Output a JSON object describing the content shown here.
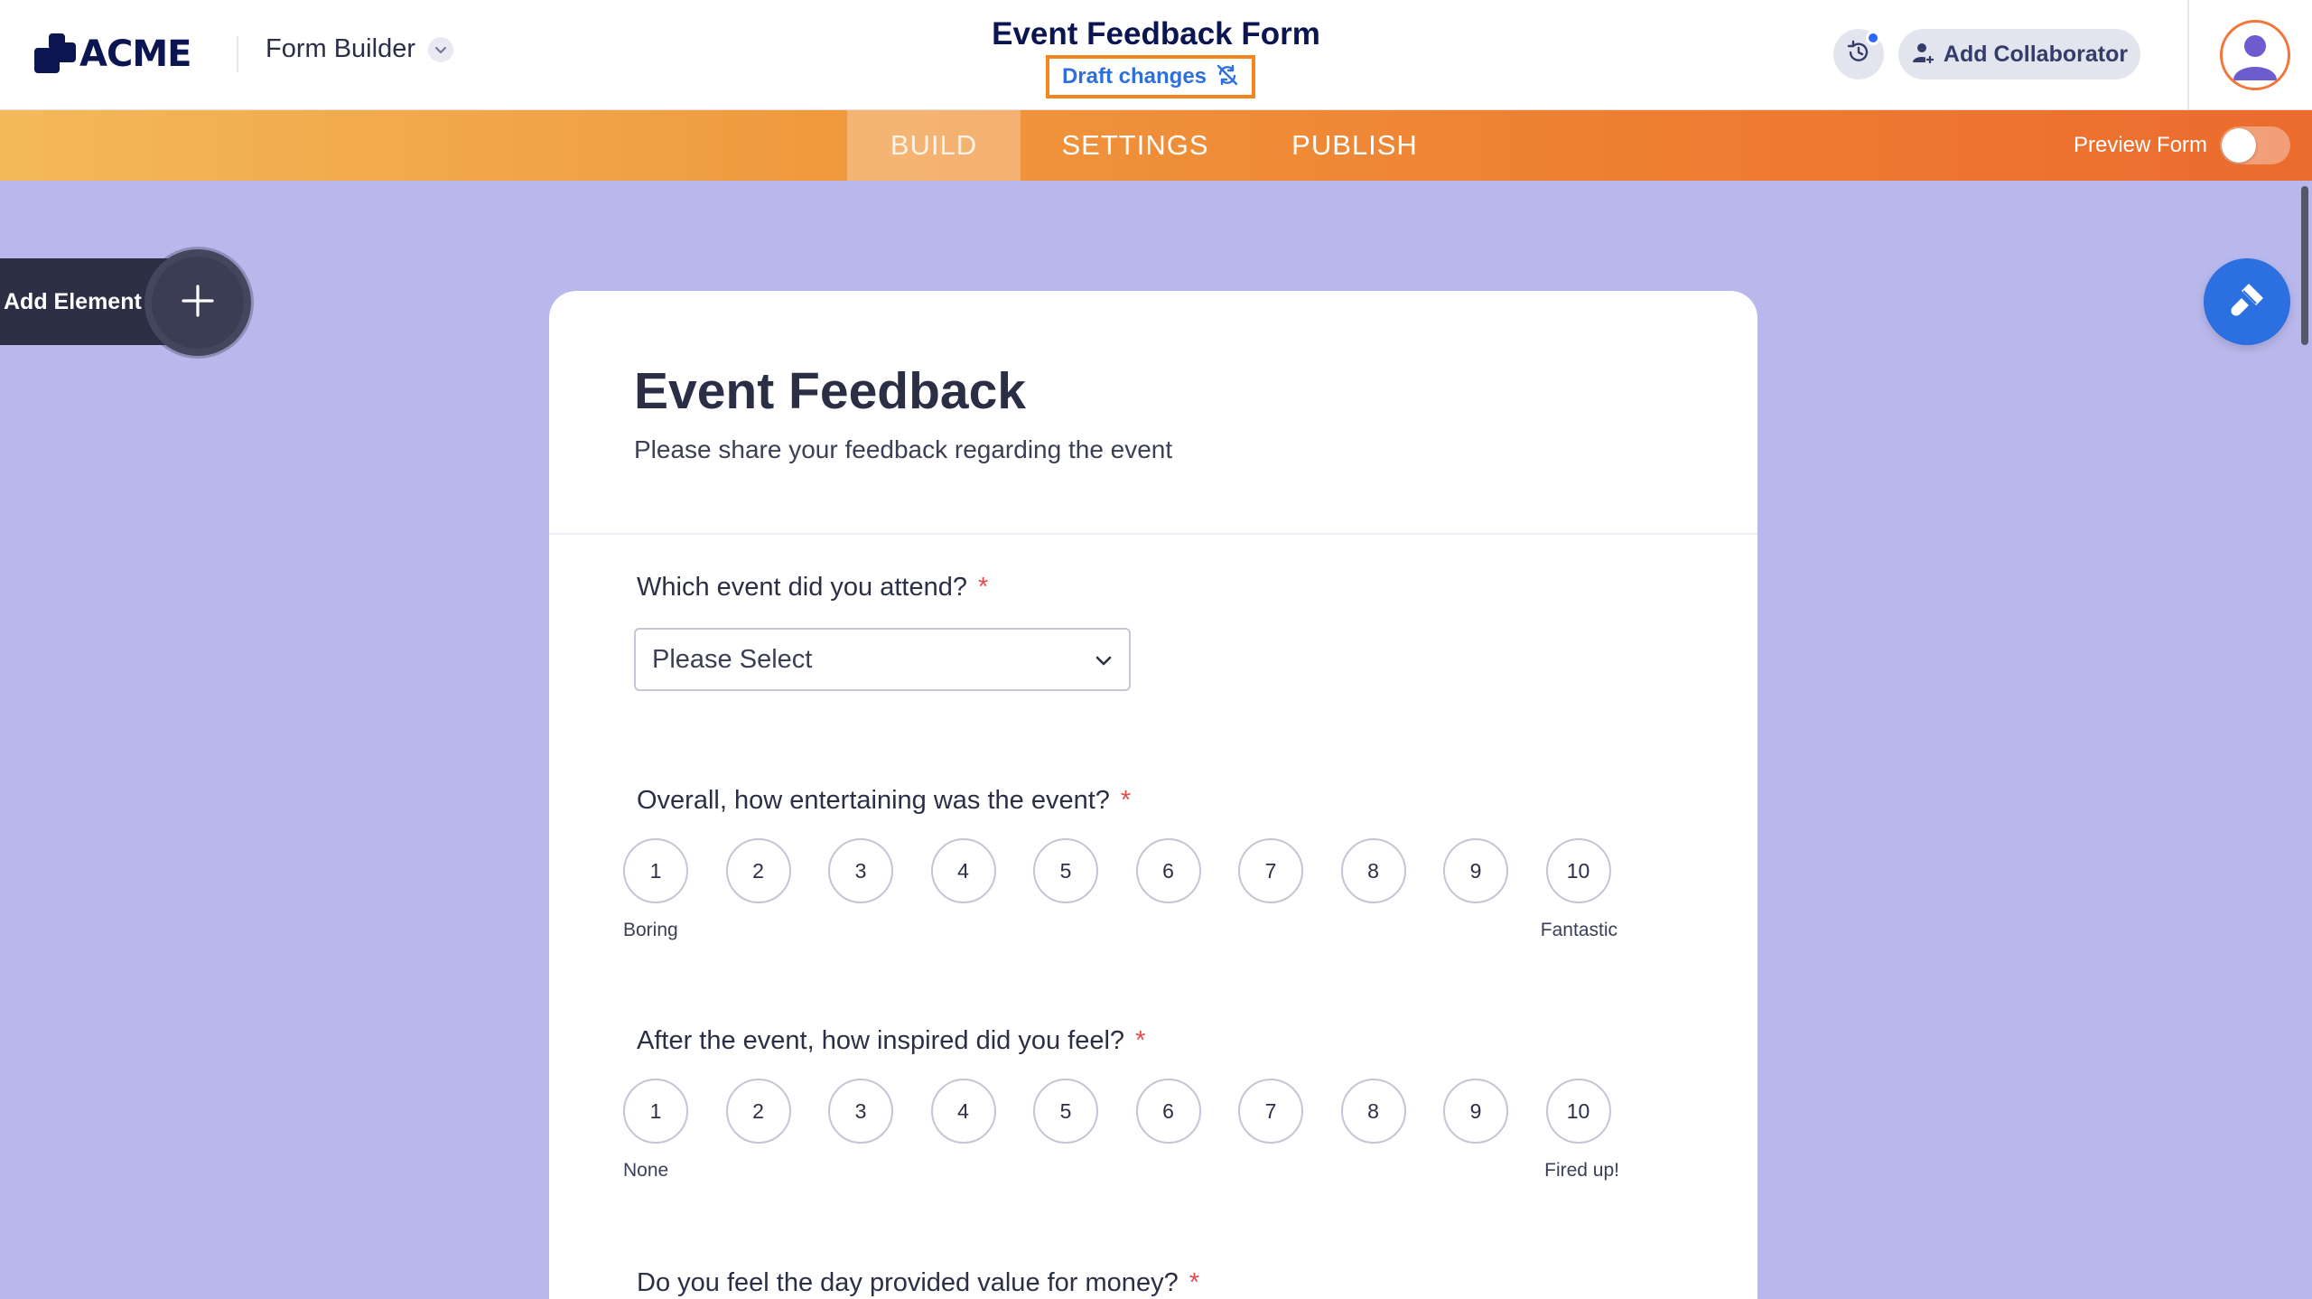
{
  "header": {
    "brand": "ACME",
    "app_name": "Form Builder",
    "form_title": "Event Feedback Form",
    "draft_label": "Draft changes",
    "add_collaborator_label": "Add Collaborator"
  },
  "tabs": [
    {
      "label": "BUILD",
      "active": true
    },
    {
      "label": "SETTINGS",
      "active": false
    },
    {
      "label": "PUBLISH",
      "active": false
    }
  ],
  "preview": {
    "label": "Preview Form",
    "enabled": false
  },
  "add_element_label": "Add Element",
  "colors": {
    "brand_navy": "#0a1551",
    "accent_orange": "#f28720",
    "canvas_bg": "#b9b8ec",
    "primary_blue": "#2b6fe0",
    "required_red": "#e04b4b"
  },
  "form": {
    "title": "Event Feedback",
    "subtitle": "Please share your feedback regarding the event",
    "questions": [
      {
        "label": "Which  event did you attend?",
        "required": "*",
        "type": "dropdown",
        "placeholder": "Please Select"
      },
      {
        "label": "Overall, how entertaining was the event?",
        "required": "*",
        "type": "scale",
        "options": [
          "1",
          "2",
          "3",
          "4",
          "5",
          "6",
          "7",
          "8",
          "9",
          "10"
        ],
        "min_label": "Boring",
        "max_label": "Fantastic"
      },
      {
        "label": "After the event, how inspired did you feel?",
        "required": "*",
        "type": "scale",
        "options": [
          "1",
          "2",
          "3",
          "4",
          "5",
          "6",
          "7",
          "8",
          "9",
          "10"
        ],
        "min_label": "None",
        "max_label": "Fired up!"
      },
      {
        "label": "Do you feel the day provided value for money?",
        "required": "*",
        "type": "unknown"
      }
    ]
  }
}
